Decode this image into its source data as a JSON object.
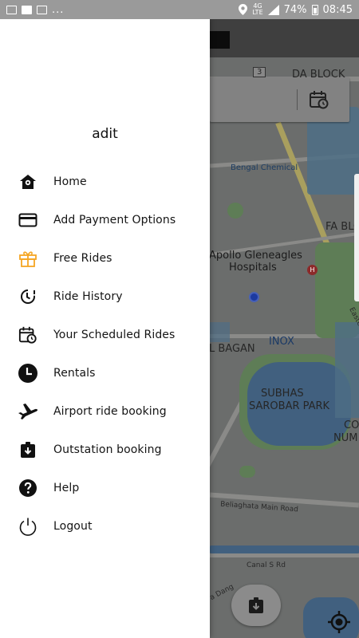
{
  "status_bar": {
    "icons": [
      "image-icon",
      "facebook-icon",
      "media-icon"
    ],
    "overflow": "...",
    "network_top": "4G",
    "network_bottom": "LTE",
    "battery": "74%",
    "time": "08:45"
  },
  "drawer": {
    "username": "adit",
    "items": [
      {
        "label": "Home",
        "icon": "home-icon"
      },
      {
        "label": "Add Payment Options",
        "icon": "credit-card-icon"
      },
      {
        "label": "Free Rides",
        "icon": "gift-icon",
        "color": "#f5a623"
      },
      {
        "label": "Ride History",
        "icon": "history-icon"
      },
      {
        "label": "Your Scheduled Rides",
        "icon": "calendar-clock-icon"
      },
      {
        "label": "Rentals",
        "icon": "clock-icon"
      },
      {
        "label": "Airport ride booking",
        "icon": "airplane-icon"
      },
      {
        "label": "Outstation booking",
        "icon": "outstation-icon"
      },
      {
        "label": "Help",
        "icon": "help-icon"
      },
      {
        "label": "Logout",
        "icon": "power-icon"
      }
    ]
  },
  "map": {
    "road_badge": "3",
    "labels": {
      "da_block": "DA BLOCK",
      "bengal_chemical": "Bengal Chemical",
      "fa_block": "FA BLO",
      "apollo_1": "Apollo Gleneagles",
      "apollo_2": "Hospitals",
      "eastern": "Easter",
      "bagan": "L BAGAN",
      "inox": "INOX",
      "subhas_1": "SUBHAS",
      "subhas_2": "SAROBAR PARK",
      "co_1": "CO",
      "co_2": "NUM",
      "beliaghata": "Beliaghata Main Road",
      "canal": "Canal S Rd",
      "danga": "a Dang"
    }
  },
  "colors": {
    "accent_gift": "#f5a623",
    "drawer_bg": "#ffffff",
    "scrim": "#6b6d6c"
  }
}
